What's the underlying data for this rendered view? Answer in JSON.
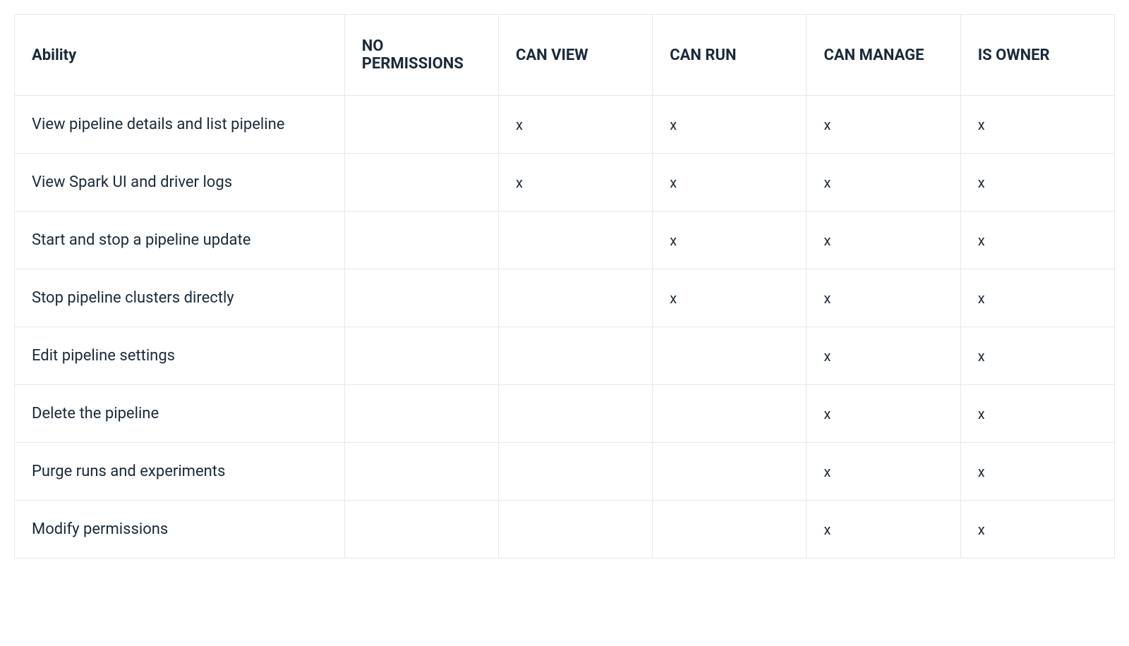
{
  "table": {
    "headers": {
      "ability": "Ability",
      "no_permissions": "NO PERMISSIONS",
      "can_view": "CAN VIEW",
      "can_run": "CAN RUN",
      "can_manage": "CAN MANAGE",
      "is_owner": "IS OWNER"
    },
    "rows": [
      {
        "ability": "View pipeline details and list pipeline",
        "no_permissions": "",
        "can_view": "x",
        "can_run": "x",
        "can_manage": "x",
        "is_owner": "x"
      },
      {
        "ability": "View Spark UI and driver logs",
        "no_permissions": "",
        "can_view": "x",
        "can_run": "x",
        "can_manage": "x",
        "is_owner": "x"
      },
      {
        "ability": "Start and stop a pipeline update",
        "no_permissions": "",
        "can_view": "",
        "can_run": "x",
        "can_manage": "x",
        "is_owner": "x"
      },
      {
        "ability": "Stop pipeline clusters directly",
        "no_permissions": "",
        "can_view": "",
        "can_run": "x",
        "can_manage": "x",
        "is_owner": "x"
      },
      {
        "ability": "Edit pipeline settings",
        "no_permissions": "",
        "can_view": "",
        "can_run": "",
        "can_manage": "x",
        "is_owner": "x"
      },
      {
        "ability": "Delete the pipeline",
        "no_permissions": "",
        "can_view": "",
        "can_run": "",
        "can_manage": "x",
        "is_owner": "x"
      },
      {
        "ability": "Purge runs and experiments",
        "no_permissions": "",
        "can_view": "",
        "can_run": "",
        "can_manage": "x",
        "is_owner": "x"
      },
      {
        "ability": "Modify permissions",
        "no_permissions": "",
        "can_view": "",
        "can_run": "",
        "can_manage": "x",
        "is_owner": "x"
      }
    ]
  }
}
